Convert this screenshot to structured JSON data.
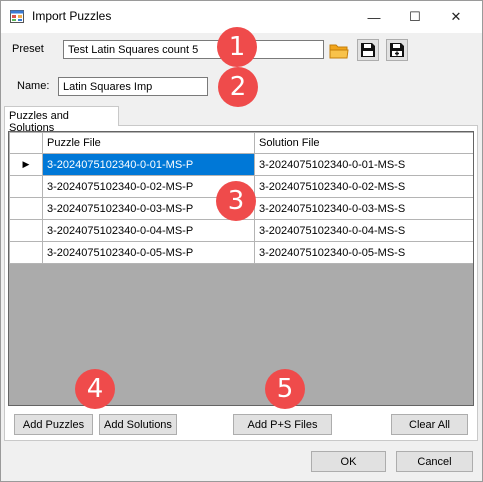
{
  "window": {
    "title": "Import Puzzles",
    "minimize_glyph": "—",
    "maximize_glyph": "☐",
    "close_glyph": "✕"
  },
  "preset": {
    "label": "Preset",
    "value": "Test Latin Squares count 5"
  },
  "name_field": {
    "label": "Name:",
    "value": "Latin Squares Imp"
  },
  "toolbar_icons": [
    "open-folder-icon",
    "save-icon",
    "save-as-icon"
  ],
  "tab": {
    "label": "Puzzles and Solutions"
  },
  "grid": {
    "columns": [
      "Puzzle File",
      "Solution File"
    ],
    "current_row_marker": "▶",
    "rows": [
      {
        "puzzle": "3-2024075102340-0-01-MS-P",
        "solution": "3-2024075102340-0-01-MS-S"
      },
      {
        "puzzle": "3-2024075102340-0-02-MS-P",
        "solution": "3-2024075102340-0-02-MS-S"
      },
      {
        "puzzle": "3-2024075102340-0-03-MS-P",
        "solution": "3-2024075102340-0-03-MS-S"
      },
      {
        "puzzle": "3-2024075102340-0-04-MS-P",
        "solution": "3-2024075102340-0-04-MS-S"
      },
      {
        "puzzle": "3-2024075102340-0-05-MS-P",
        "solution": "3-2024075102340-0-05-MS-S"
      }
    ]
  },
  "buttons": {
    "add_puzzles": "Add Puzzles",
    "add_solutions": "Add Solutions",
    "add_ps_files": "Add P+S Files",
    "clear_all": "Clear All",
    "ok": "OK",
    "cancel": "Cancel"
  },
  "callouts": [
    "1",
    "2",
    "3",
    "4",
    "5"
  ],
  "colors": {
    "callout": "#ef4b4b",
    "selection": "#0078d7",
    "grid_background": "#ababab",
    "folder_icon": "#f2a51a"
  }
}
